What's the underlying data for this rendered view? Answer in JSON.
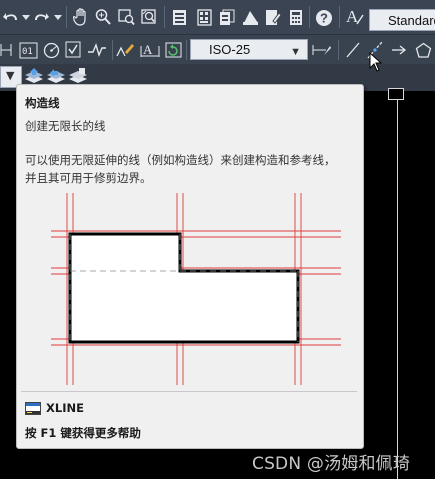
{
  "toolbar1": {
    "text_style_value": "Standard"
  },
  "toolbar2": {
    "dim_style_value": "ISO-25"
  },
  "tooltip": {
    "title": "构造线",
    "subtitle": "创建无限长的线",
    "description_line1": "可以使用无限延伸的线（例如构造线）来创建构造和参考线，",
    "description_line2": "并且其可用于修剪边界。",
    "command_name": "XLINE",
    "help_text": "按 F1 键获得更多帮助"
  },
  "watermark": "CSDN @汤姆和佩琦",
  "icons": [
    "undo-icon",
    "redo-icon",
    "pan-hand-icon",
    "zoom-realtime-icon",
    "zoom-window-icon",
    "zoom-previous-icon",
    "properties-icon",
    "design-center-icon",
    "tool-palettes-icon",
    "sheet-set-icon",
    "markup-icon",
    "calculator-icon",
    "help-icon",
    "text-style-icon",
    "dim-style-icon",
    "xline-icon",
    "ray-icon",
    "polygon-icon",
    "cursor-icon"
  ],
  "colors": {
    "toolbar_bg": "#3b4453",
    "tooltip_bg": "#f0f0f0",
    "construction_line": "#e03a3a",
    "canvas_bg": "#000000"
  }
}
